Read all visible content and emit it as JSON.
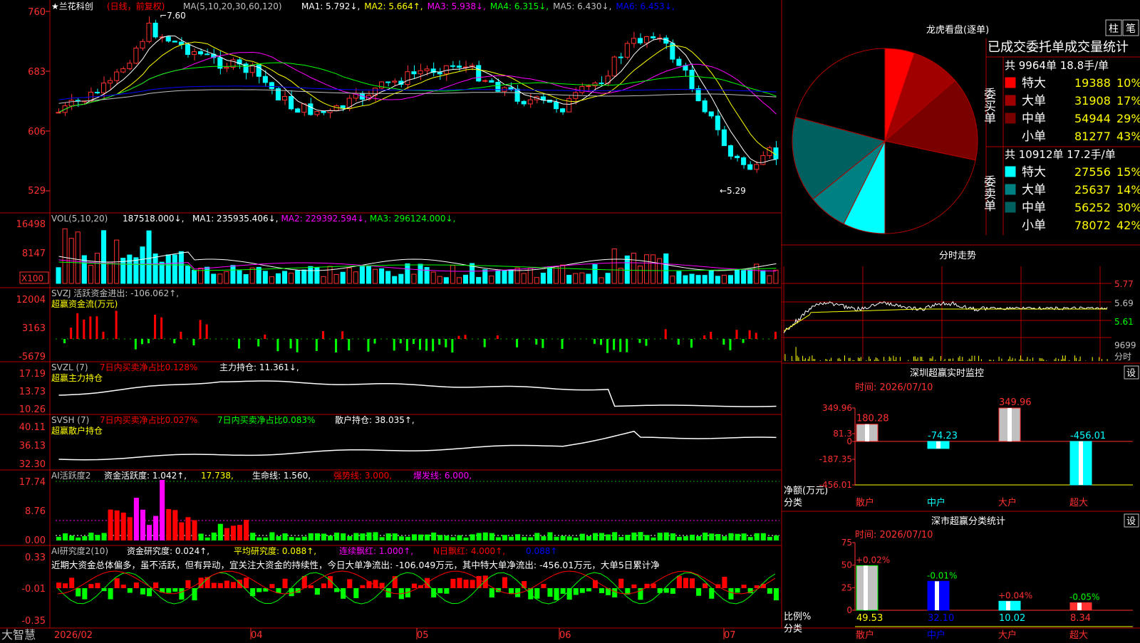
{
  "stock": {
    "name": "兰花科创",
    "mode": "(日线，前复权)",
    "ma_header": "MA(5,10,20,30,60,120)",
    "ma": [
      {
        "label": "MA1:",
        "value": "5.792",
        "arrow": "↓",
        "color": "#ffffff"
      },
      {
        "label": "MA2:",
        "value": "5.664",
        "arrow": "↑",
        "color": "#ffff00"
      },
      {
        "label": "MA3:",
        "value": "5.938",
        "arrow": "↓",
        "color": "#ff00ff"
      },
      {
        "label": "MA4:",
        "value": "6.315",
        "arrow": "↓",
        "color": "#00ff00"
      },
      {
        "label": "MA5:",
        "value": "6.430",
        "arrow": "↓",
        "color": "#c0c0c0"
      },
      {
        "label": "MA6:",
        "value": "6.453",
        "arrow": "↓",
        "color": "#0000ff"
      }
    ],
    "price_ticks": [
      "760",
      "683",
      "606",
      "529"
    ],
    "high_mark": "7.60",
    "low_mark": "←5.29"
  },
  "volume": {
    "header": "VOL(5,10,20)",
    "value": "187518.000",
    "ma": [
      {
        "label": "MA1:",
        "value": "235935.406",
        "arrow": "↓",
        "color": "#ffffff"
      },
      {
        "label": "MA2:",
        "value": "229392.594",
        "arrow": "↓",
        "color": "#ff00ff"
      },
      {
        "label": "MA3:",
        "value": "296124.000",
        "arrow": "↓",
        "color": "#00ff00"
      }
    ],
    "ticks": [
      "16498",
      "8147"
    ],
    "unit": "X100"
  },
  "svzj": {
    "header": "SVZJ  活跃资金进出: -106.062↑,",
    "sub": "超赢资金流(万元)",
    "ticks": [
      "12004",
      "3163",
      "-5679"
    ]
  },
  "svzl": {
    "header_a": "SVZL (7)",
    "header_b": "7日内买卖净占比0.128%",
    "header_c": "主力持仓: 11.361↓,",
    "sub": "超赢主力持仓",
    "ticks": [
      "17.19",
      "13.73",
      "10.26"
    ]
  },
  "svsh": {
    "header_a": "SVSH (7)",
    "header_b": "7日内买卖净占比0.027%",
    "header_c": "7日内买卖净占比0.083%",
    "header_d": "散户持仓: 38.035↑,",
    "sub": "超赢散户持仓",
    "ticks": [
      "40.11",
      "36.13",
      "32.30"
    ]
  },
  "ai_active": {
    "header_a": "AI活跃度2",
    "header_b": "资金活跃度: 1.042↑,",
    "header_c": "17.738,",
    "header_d": "生命线: 1.560,",
    "header_e": "强势线: 3.000,",
    "header_f": "爆发线: 6.000,",
    "ticks": [
      "17.74",
      "8.76",
      "0.00"
    ]
  },
  "ai_research": {
    "header_a": "AI研究度2(10)",
    "header_b": "资金研究度: 0.024↑,",
    "header_c": "平均研究度: 0.088↑,",
    "header_d": "连续飘红: 1.000↑,",
    "header_e": "N日飘红: 4.000↑,",
    "header_f": "0.088↑",
    "text": "近期大资金总体偏多，虽不活跃，但有异动，宜关注大资金的持续性，今日大单净流出: -106.049万元，其中特大单净流出: -456.01万元，大单5日累计净",
    "ticks": [
      "0.33",
      "-0.01",
      "-0.35"
    ]
  },
  "bottom": {
    "brand": "大智慧",
    "dates": [
      "2026/02",
      "04",
      "05",
      "06",
      "07"
    ]
  },
  "longhu": {
    "title": "龙虎看盘(逐单)",
    "tab1": "柱",
    "tab2": "笔",
    "table_title": "已成交委托单成交量统计",
    "buy_label": "委买单",
    "sell_label": "委卖单",
    "buy_total": "共 9964单 18.8手/单",
    "sell_total": "共 10912单 17.2手/单",
    "buy_rows": [
      {
        "label": "特大",
        "vol": "19388",
        "pct": "10%",
        "color": "#ff0000"
      },
      {
        "label": "大单",
        "vol": "31908",
        "pct": "17%",
        "color": "#a00000"
      },
      {
        "label": "中单",
        "vol": "54944",
        "pct": "29%",
        "color": "#7a0000"
      },
      {
        "label": "小单",
        "vol": "81277",
        "pct": "43%",
        "color": "#000000"
      }
    ],
    "sell_rows": [
      {
        "label": "特大",
        "vol": "27556",
        "pct": "15%",
        "color": "#00ffff"
      },
      {
        "label": "大单",
        "vol": "25637",
        "pct": "14%",
        "color": "#008080"
      },
      {
        "label": "中单",
        "vol": "56252",
        "pct": "30%",
        "color": "#006060"
      },
      {
        "label": "小单",
        "vol": "78072",
        "pct": "42%",
        "color": "#000000"
      }
    ]
  },
  "intraday": {
    "title": "分时走势",
    "ticks": [
      "5.77",
      "5.69",
      "5.61"
    ],
    "vol_tick": "9699",
    "vol_label": "分时"
  },
  "sz_monitor": {
    "title": "深圳超赢实时监控",
    "set": "设",
    "time": "时间: 2026/07/10",
    "ticks": [
      "349.96",
      "81.3",
      "0",
      "-187.35",
      "-456.01"
    ],
    "y_label": "净额(万元)",
    "x_label": "分类",
    "categories": [
      "散户",
      "中户",
      "大户",
      "超大"
    ],
    "values": [
      180.28,
      -74.23,
      349.96,
      -456.01
    ],
    "value_labels": [
      "180.28",
      "-74.23",
      "349.96",
      "-456.01"
    ]
  },
  "sz_class": {
    "title": "深市超赢分类统计",
    "set": "设",
    "time": "时间: 2026/07/10",
    "ticks": [
      "75",
      "50",
      "25",
      "0"
    ],
    "y_label": "比例%",
    "x_label": "分类",
    "categories": [
      "散户",
      "中户",
      "大户",
      "超大"
    ],
    "values": [
      49.53,
      32.1,
      10.02,
      8.34
    ],
    "value_labels": [
      "49.53",
      "32.10",
      "10.02",
      "8.34"
    ],
    "changes": [
      "+0.02%",
      "-0.01%",
      "+0.04%",
      "-0.05%"
    ]
  },
  "chart_data": [
    {
      "type": "pie",
      "title": "龙虎看盘(逐单)",
      "categories": [
        "买-特大",
        "买-大单",
        "买-中单",
        "买-小单",
        "卖-特大",
        "卖-大单",
        "卖-中单",
        "卖-小单"
      ],
      "values": [
        19388,
        31908,
        54944,
        81277,
        27556,
        25637,
        56252,
        78072
      ]
    },
    {
      "type": "bar",
      "title": "深圳超赢实时监控",
      "categories": [
        "散户",
        "中户",
        "大户",
        "超大"
      ],
      "values": [
        180.28,
        -74.23,
        349.96,
        -456.01
      ],
      "ylabel": "净额(万元)",
      "xlabel": "分类",
      "ylim": [
        -456.01,
        349.96
      ]
    },
    {
      "type": "bar",
      "title": "深市超赢分类统计",
      "categories": [
        "散户",
        "中户",
        "大户",
        "超大"
      ],
      "values": [
        49.53,
        32.1,
        10.02,
        8.34
      ],
      "ylabel": "比例%",
      "xlabel": "分类",
      "ylim": [
        0,
        75
      ]
    }
  ]
}
